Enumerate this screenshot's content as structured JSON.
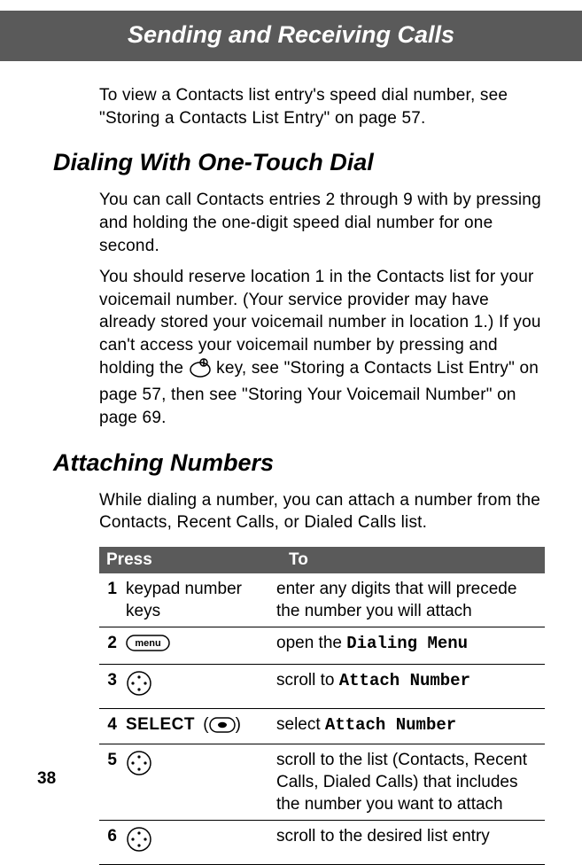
{
  "header": {
    "title": "Sending and Receiving Calls"
  },
  "intro": "To view a Contacts list entry's speed dial number, see \"Storing a Contacts List Entry\" on page 57.",
  "section1": {
    "heading": "Dialing With One-Touch Dial",
    "p1": "You can call Contacts entries 2 through 9 with by pressing and holding the one-digit speed dial number for one second.",
    "p2a": "You should reserve location 1 in the Contacts list for your voicemail number. (Your service provider may have already stored your voicemail number in location 1.) If you can't access your voicemail number by pressing and holding the ",
    "p2b": " key, see \"Storing a Contacts List Entry\" on page 57, then see \"Storing Your Voicemail Number\" on page 69."
  },
  "section2": {
    "heading": "Attaching Numbers",
    "p1": "While dialing a number, you can attach a number from the Contacts, Recent Calls, or Dialed Calls list.",
    "table": {
      "head": {
        "press": "Press",
        "to": "To"
      },
      "rows": [
        {
          "n": "1",
          "press_text": "keypad number keys",
          "press_icon": null,
          "to_pre": "enter any digits that will precede the number you will attach",
          "to_mono": ""
        },
        {
          "n": "2",
          "press_text": "",
          "press_icon": "menu",
          "to_pre": "open the ",
          "to_mono": "Dialing Menu"
        },
        {
          "n": "3",
          "press_text": "",
          "press_icon": "nav",
          "to_pre": "scroll to ",
          "to_mono": "Attach Number"
        },
        {
          "n": "4",
          "press_text": "SELECT",
          "press_icon": "dot",
          "to_pre": "select ",
          "to_mono": "Attach Number"
        },
        {
          "n": "5",
          "press_text": "",
          "press_icon": "nav",
          "to_pre": "scroll to the list (Contacts, Recent Calls, Dialed Calls) that includes the number you want to attach",
          "to_mono": ""
        },
        {
          "n": "6",
          "press_text": "",
          "press_icon": "nav",
          "to_pre": "scroll to the desired list entry",
          "to_mono": ""
        }
      ]
    }
  },
  "page_number": "38",
  "icons": {
    "menu_label": "menu"
  }
}
